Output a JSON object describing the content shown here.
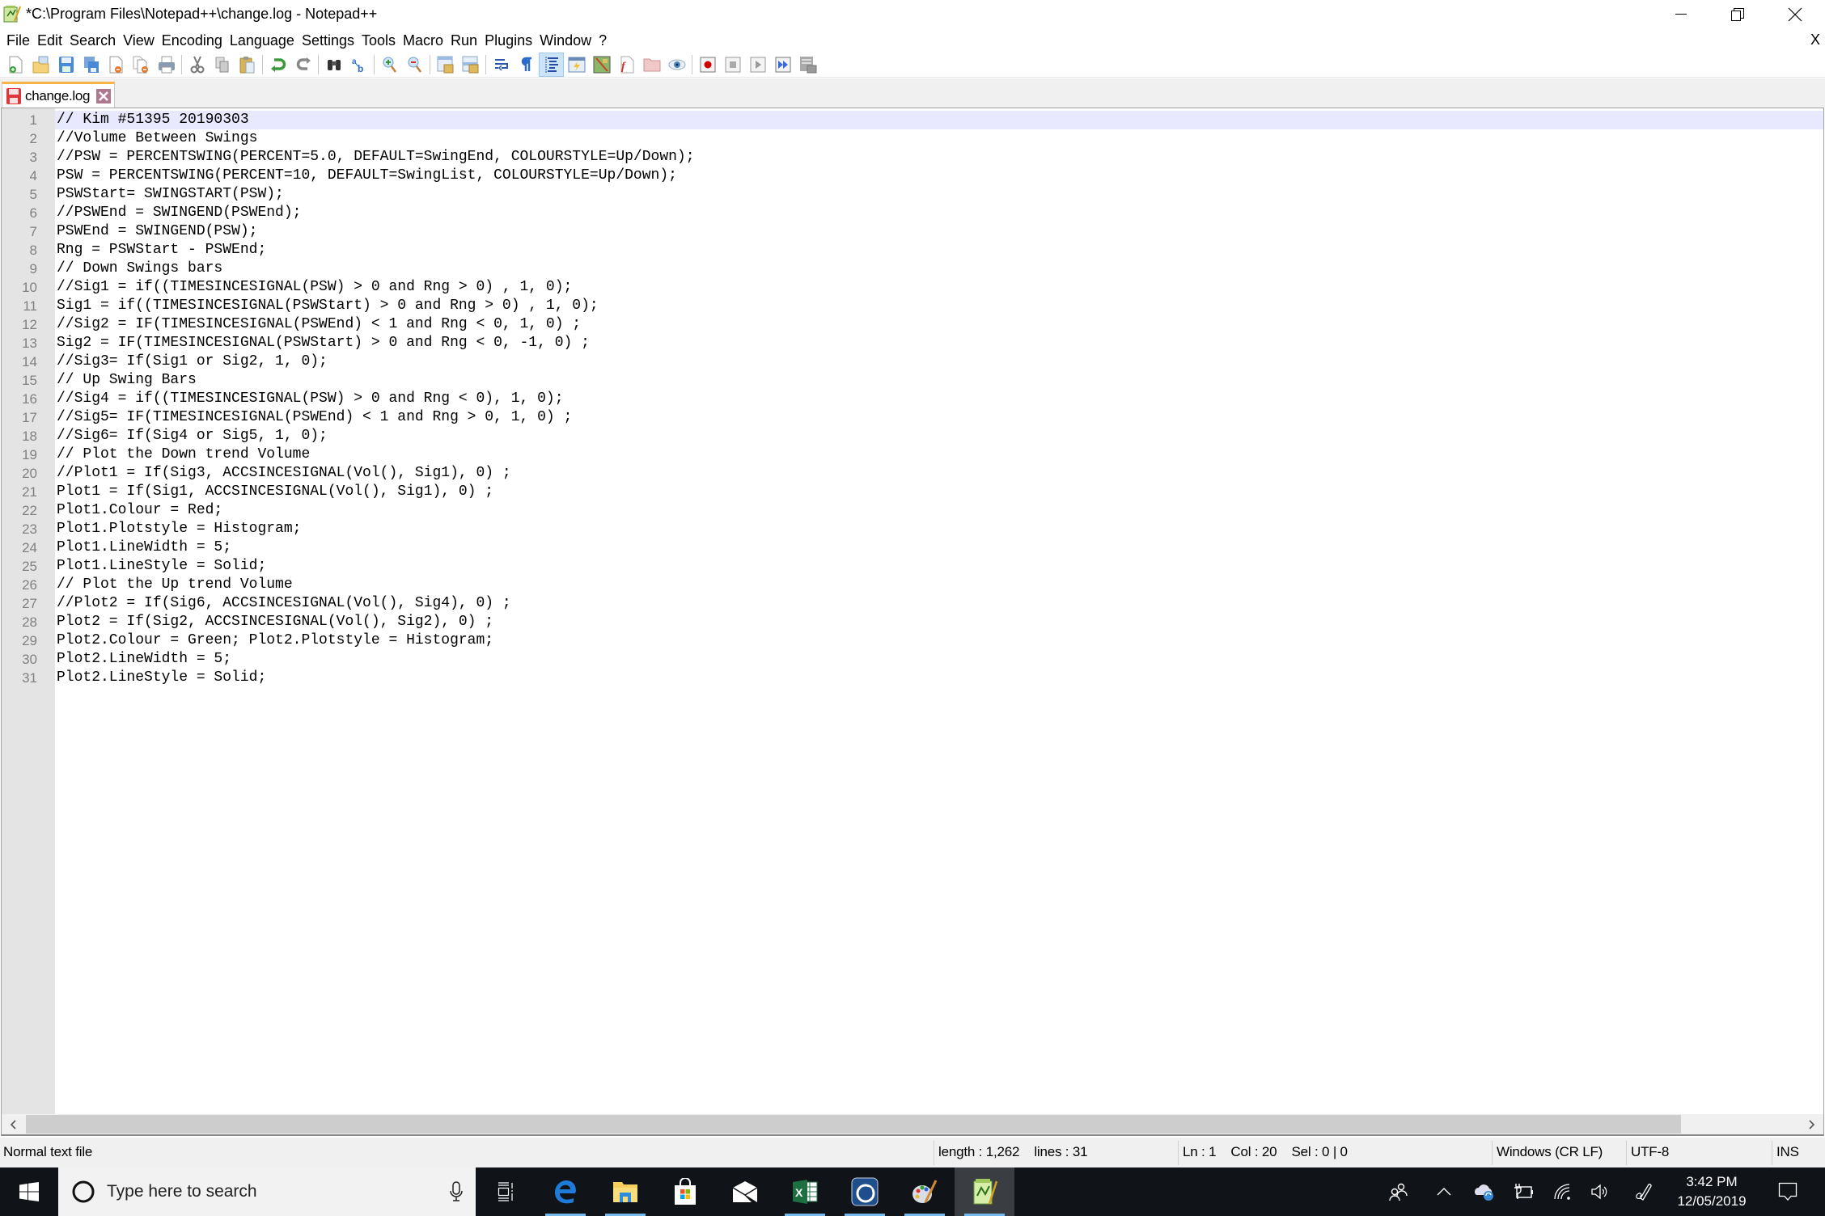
{
  "window": {
    "title": "*C:\\Program Files\\Notepad++\\change.log - Notepad++",
    "controls": [
      "minimize",
      "restore",
      "close"
    ]
  },
  "menu": {
    "items": [
      "File",
      "Edit",
      "Search",
      "View",
      "Encoding",
      "Language",
      "Settings",
      "Tools",
      "Macro",
      "Run",
      "Plugins",
      "Window",
      "?"
    ],
    "close_doc": "X"
  },
  "toolbar": {
    "buttons": [
      "new-file",
      "open-file",
      "save",
      "save-all",
      "close",
      "close-all",
      "print",
      "cut",
      "copy",
      "paste",
      "undo",
      "redo",
      "find",
      "replace",
      "zoom-in",
      "zoom-out",
      "sync-vertical-scroll",
      "sync-horizontal-scroll",
      "word-wrap",
      "show-all-characters",
      "indent-guide",
      "user-defined-language",
      "document-map",
      "function-list",
      "folder-as-workspace",
      "monitoring",
      "start-recording",
      "stop-recording",
      "playback",
      "run-macro-multiple",
      "save-recorded-macro"
    ],
    "active_button": "indent-guide"
  },
  "tabs": [
    {
      "label": "change.log",
      "modified": true,
      "active": true
    }
  ],
  "editor": {
    "current_line": 1,
    "lines": [
      "// Kim #51395 20190303",
      "//Volume Between Swings",
      "//PSW = PERCENTSWING(PERCENT=5.0, DEFAULT=SwingEnd, COLOURSTYLE=Up/Down);",
      "PSW = PERCENTSWING(PERCENT=10, DEFAULT=SwingList, COLOURSTYLE=Up/Down);",
      "PSWStart= SWINGSTART(PSW);",
      "//PSWEnd = SWINGEND(PSWEnd);",
      "PSWEnd = SWINGEND(PSW);",
      "Rng = PSWStart - PSWEnd;",
      "// Down Swings bars",
      "//Sig1 = if((TIMESINCESIGNAL(PSW) > 0 and Rng > 0) , 1, 0);",
      "Sig1 = if((TIMESINCESIGNAL(PSWStart) > 0 and Rng > 0) , 1, 0);",
      "//Sig2 = IF(TIMESINCESIGNAL(PSWEnd) < 1 and Rng < 0, 1, 0) ;",
      "Sig2 = IF(TIMESINCESIGNAL(PSWStart) > 0 and Rng < 0, -1, 0) ;",
      "//Sig3= If(Sig1 or Sig2, 1, 0);",
      "// Up Swing Bars",
      "//Sig4 = if((TIMESINCESIGNAL(PSW) > 0 and Rng < 0), 1, 0);",
      "//Sig5= IF(TIMESINCESIGNAL(PSWEnd) < 1 and Rng > 0, 1, 0) ;",
      "//Sig6= If(Sig4 or Sig5, 1, 0);",
      "// Plot the Down trend Volume",
      "//Plot1 = If(Sig3, ACCSINCESIGNAL(Vol(), Sig1), 0) ;",
      "Plot1 = If(Sig1, ACCSINCESIGNAL(Vol(), Sig1), 0) ;",
      "Plot1.Colour = Red;",
      "Plot1.Plotstyle = Histogram;",
      "Plot1.LineWidth = 5;",
      "Plot1.LineStyle = Solid;",
      "// Plot the Up trend Volume",
      "//Plot2 = If(Sig6, ACCSINCESIGNAL(Vol(), Sig4), 0) ;",
      "Plot2 = If(Sig2, ACCSINCESIGNAL(Vol(), Sig2), 0) ;",
      "Plot2.Colour = Green; Plot2.Plotstyle = Histogram;",
      "Plot2.LineWidth = 5;",
      "Plot2.LineStyle = Solid;"
    ]
  },
  "statusbar": {
    "file_type": "Normal text file",
    "length_lines": "length : 1,262    lines : 31",
    "position": "Ln : 1    Col : 20    Sel : 0 | 0",
    "eol": "Windows (CR LF)",
    "encoding": "UTF-8",
    "mode": "INS"
  },
  "taskbar": {
    "search_placeholder": "Type here to search",
    "apps": [
      {
        "name": "task-view",
        "running": false
      },
      {
        "name": "edge",
        "running": true
      },
      {
        "name": "file-explorer",
        "running": true
      },
      {
        "name": "microsoft-store",
        "running": false
      },
      {
        "name": "mail",
        "running": false
      },
      {
        "name": "excel",
        "running": true
      },
      {
        "name": "app-blue-circle",
        "running": true
      },
      {
        "name": "paint",
        "running": true
      },
      {
        "name": "notepad-plus-plus",
        "running": true,
        "active": true
      }
    ],
    "tray": [
      "people",
      "show-hidden-icons",
      "onedrive",
      "power",
      "wifi",
      "volume",
      "pen-workspace"
    ],
    "time": "3:42 PM",
    "date": "12/05/2019"
  },
  "colors": {
    "tab_accent": "#fab446",
    "current_line": "#e8e8ff",
    "gutter": "#e4e4e4",
    "taskbar": "#101318"
  }
}
